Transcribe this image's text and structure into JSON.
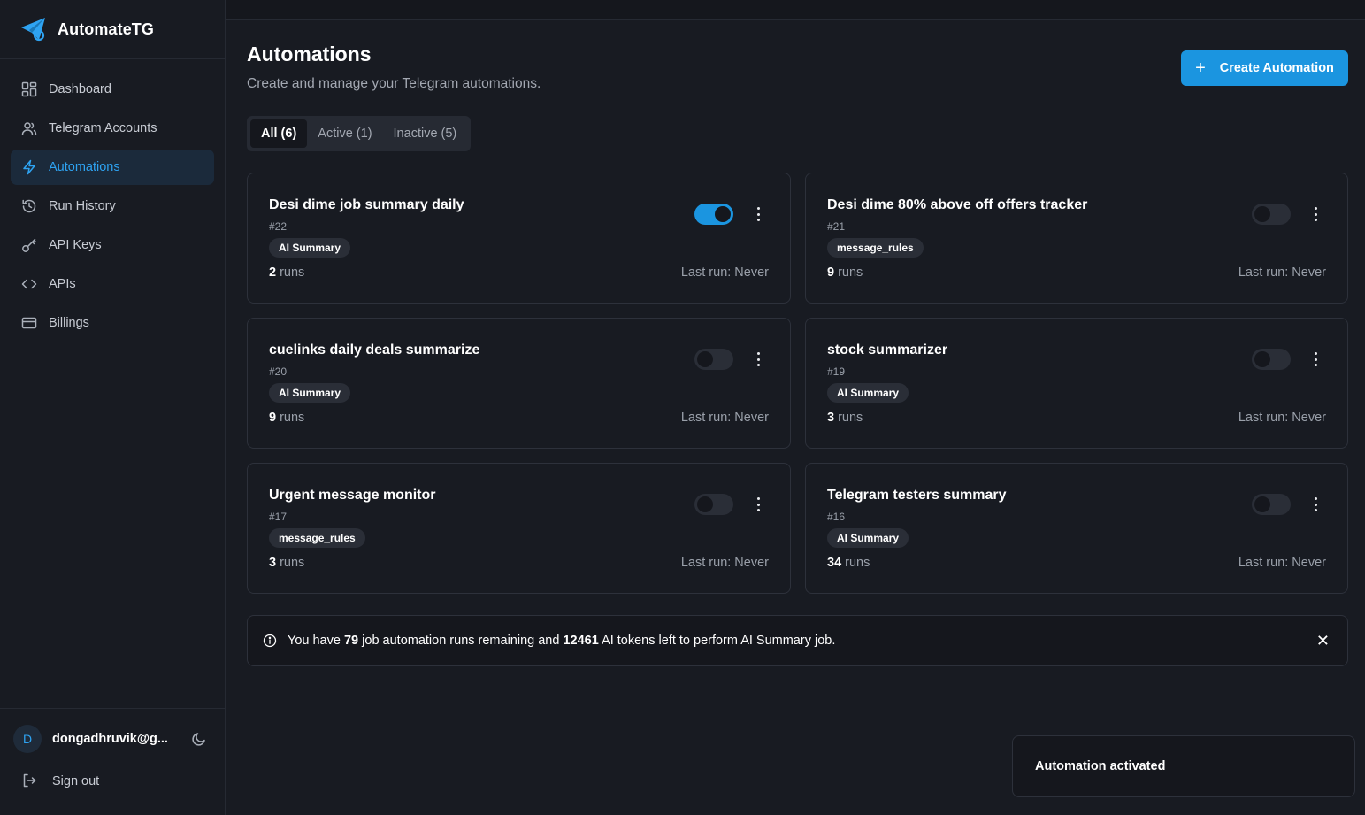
{
  "brand": {
    "name": "AutomateTG",
    "logo_icon": "paper-plane-gear-icon",
    "accent": "#2ea3f2"
  },
  "sidebar": {
    "items": [
      {
        "label": "Dashboard",
        "icon": "grid-icon"
      },
      {
        "label": "Telegram Accounts",
        "icon": "users-icon"
      },
      {
        "label": "Automations",
        "icon": "lightning-icon",
        "active": true
      },
      {
        "label": "Run History",
        "icon": "history-icon"
      },
      {
        "label": "API Keys",
        "icon": "key-icon"
      },
      {
        "label": "APIs",
        "icon": "code-icon"
      },
      {
        "label": "Billings",
        "icon": "credit-card-icon"
      }
    ],
    "user": {
      "initial": "D",
      "email": "dongadhruvik@g..."
    },
    "signout_label": "Sign out"
  },
  "header": {
    "title": "Automations",
    "subtitle": "Create and manage your Telegram automations.",
    "create_label": "Create Automation"
  },
  "tabs": [
    {
      "label": "All (6)",
      "active": true
    },
    {
      "label": "Active (1)"
    },
    {
      "label": "Inactive (5)"
    }
  ],
  "automations": [
    {
      "title": "Desi dime job summary daily",
      "id": "#22",
      "type": "AI Summary",
      "runs_count": "2",
      "runs_label": "runs",
      "last_run": "Last run: Never",
      "enabled": true
    },
    {
      "title": "Desi dime 80% above off offers tracker",
      "id": "#21",
      "type": "message_rules",
      "runs_count": "9",
      "runs_label": "runs",
      "last_run": "Last run: Never",
      "enabled": false
    },
    {
      "title": "cuelinks daily deals summarize",
      "id": "#20",
      "type": "AI Summary",
      "runs_count": "9",
      "runs_label": "runs",
      "last_run": "Last run: Never",
      "enabled": false
    },
    {
      "title": "stock summarizer",
      "id": "#19",
      "type": "AI Summary",
      "runs_count": "3",
      "runs_label": "runs",
      "last_run": "Last run: Never",
      "enabled": false
    },
    {
      "title": "Urgent message monitor",
      "id": "#17",
      "type": "message_rules",
      "runs_count": "3",
      "runs_label": "runs",
      "last_run": "Last run: Never",
      "enabled": false
    },
    {
      "title": "Telegram testers summary",
      "id": "#16",
      "type": "AI Summary",
      "runs_count": "34",
      "runs_label": "runs",
      "last_run": "Last run: Never",
      "enabled": false
    }
  ],
  "alert": {
    "prefix": "You have",
    "runs_remaining": "79",
    "middle": "job automation runs remaining and",
    "tokens_left": "12461",
    "suffix": "AI tokens left to perform AI Summary job."
  },
  "toast": {
    "message": "Automation activated"
  }
}
